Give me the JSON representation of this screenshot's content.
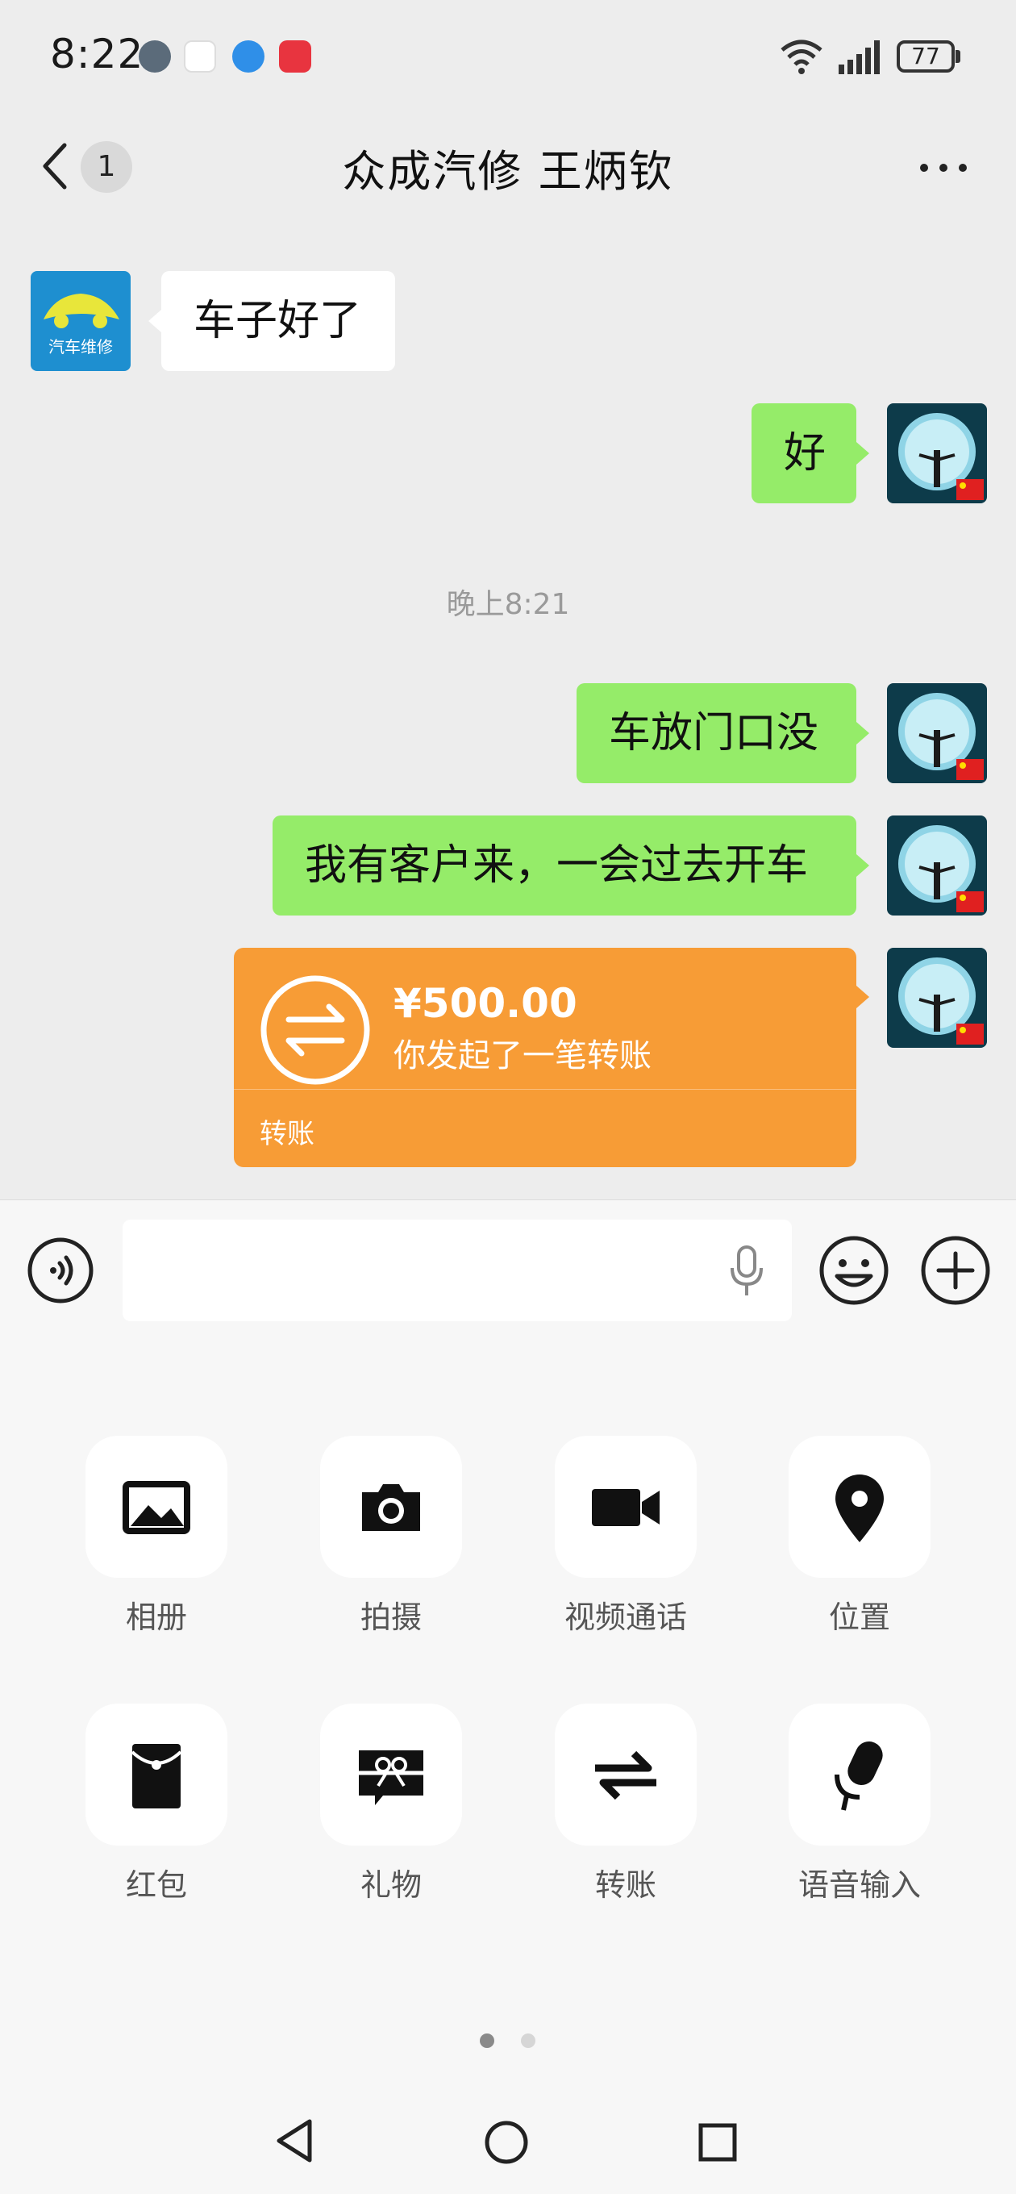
{
  "status_bar": {
    "time": "8:22",
    "battery": "77",
    "icons": [
      "wifi-icon",
      "signal-icon",
      "battery-icon"
    ]
  },
  "header": {
    "unread_count": "1",
    "title": "众成汽修   王炳钦",
    "back_icon": "chevron-left-icon",
    "more_icon": "more-dots-icon"
  },
  "avatar_logo_text": "汽车维修",
  "messages": [
    {
      "side": "left",
      "text": "车子好了"
    },
    {
      "side": "right",
      "text": "好"
    },
    {
      "side": "right",
      "text": "车放门口没"
    },
    {
      "side": "right",
      "text": "我有客户来，一会过去开车"
    }
  ],
  "time_divider": "晚上8:21",
  "transfer": {
    "amount": "¥500.00",
    "description": "你发起了一笔转账",
    "label": "转账"
  },
  "input": {
    "value": "",
    "placeholder": ""
  },
  "panel": {
    "items": [
      {
        "label": "相册",
        "icon": "album-icon"
      },
      {
        "label": "拍摄",
        "icon": "camera-icon"
      },
      {
        "label": "视频通话",
        "icon": "video-call-icon"
      },
      {
        "label": "位置",
        "icon": "location-pin-icon"
      },
      {
        "label": "红包",
        "icon": "red-packet-icon"
      },
      {
        "label": "礼物",
        "icon": "gift-icon"
      },
      {
        "label": "转账",
        "icon": "transfer-icon"
      },
      {
        "label": "语音输入",
        "icon": "voice-input-icon"
      }
    ],
    "page_indicator": {
      "pages": 2,
      "current": 1
    }
  },
  "colors": {
    "chat_bg": "#ededed",
    "sent_bubble": "#95ec69",
    "received_bubble": "#ffffff",
    "transfer_card": "#f79c36",
    "panel_bg": "#f7f7f7"
  }
}
